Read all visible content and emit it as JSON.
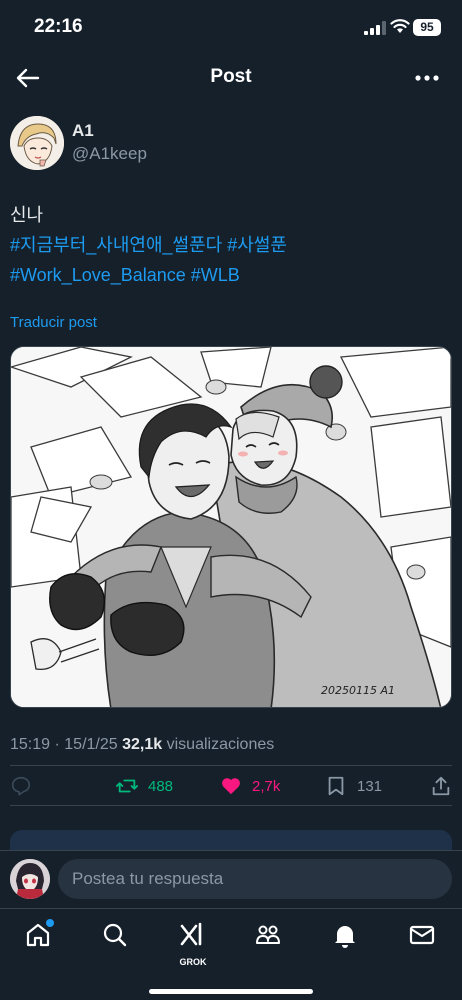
{
  "status_bar": {
    "time": "22:16",
    "battery": "95"
  },
  "header": {
    "title": "Post"
  },
  "author": {
    "name": "A1",
    "handle": "@A1keep"
  },
  "post": {
    "line1": "신나",
    "hashtags_line2": [
      "#지금부터_사내연애_썰푼다",
      "#사썰푼"
    ],
    "hashtags_line3": [
      "#Work_Love_Balance",
      "#WLB"
    ],
    "translate_label": "Traducir post",
    "image_signature": "20250115 A1",
    "time": "15:19",
    "separator": "·",
    "date": "15/1/25",
    "views_count": "32,1k",
    "views_label": "visualizaciones"
  },
  "actions": {
    "retweets": "488",
    "likes": "2,7k",
    "bookmarks": "131"
  },
  "reply": {
    "placeholder": "Postea tu respuesta"
  },
  "tabbar": {
    "grok_label": "GROK"
  },
  "colors": {
    "background": "#15202b",
    "accent": "#1d9bf0",
    "retweet": "#00ba7c",
    "like": "#f91880",
    "muted": "#8b98a5"
  }
}
